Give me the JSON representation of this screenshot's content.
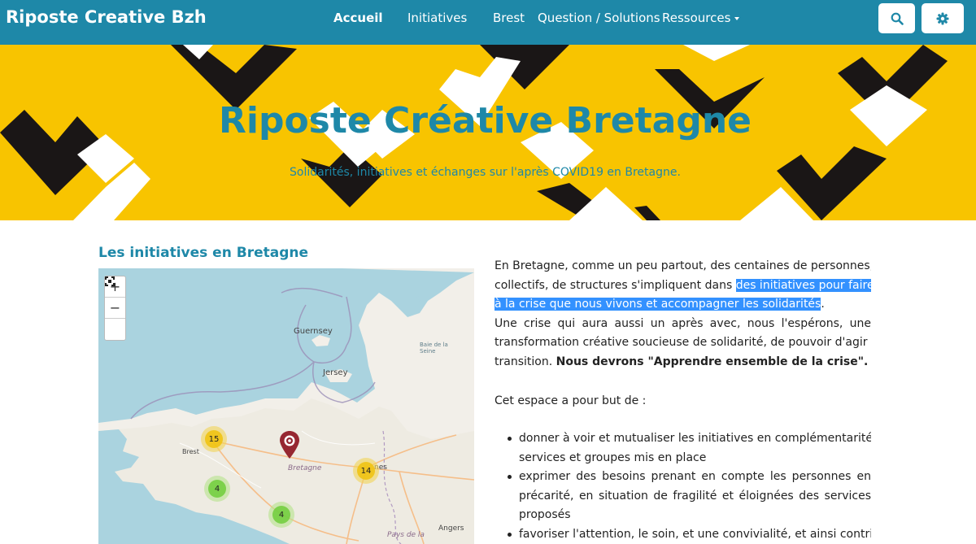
{
  "navbar": {
    "brand": "Riposte Creative Bzh",
    "links": [
      "Accueil",
      "Initiatives",
      "Brest",
      "Question / Solutions",
      "Ressources"
    ],
    "active": "Accueil",
    "search_icon": "search-icon",
    "settings_icon": "gear-icon",
    "color": "#1e88a8"
  },
  "hero": {
    "title": "Riposte Créative Bretagne",
    "subtitle": "Solidarités, initiatives et échanges sur l'après COVID19 en Bretagne.",
    "background": "#f8c400"
  },
  "section": {
    "title": "Les initiatives en Bretagne"
  },
  "map": {
    "zoom_in": "+",
    "zoom_out": "−",
    "labels": {
      "guernsey": "Guernsey",
      "jersey": "Jersey",
      "brest": "Brest",
      "bretagne": "Bretagne",
      "angers": "Angers",
      "pays_de_la": "Pays de la",
      "baie": "Baie de la Seine",
      "rennes_partial": "nes"
    },
    "clusters": [
      {
        "count": "15",
        "color": "yellow"
      },
      {
        "count": "14",
        "color": "yellow"
      },
      {
        "count": "4",
        "color": "green"
      },
      {
        "count": "4",
        "color": "green"
      }
    ],
    "marker_icon": "map-marker-icon",
    "fullscreen_icon": "fullscreen-icon"
  },
  "intro": {
    "l1": "En Bretagne, comme un peu partout, des centaines de personnes, de",
    "l2a": "collectifs, de structures s'impliquent dans ",
    "l2b": "des initiatives pour faire face",
    "l3a": "à la crise que nous vivons et accompagner les solidarités",
    "l3b": ".",
    "l4": "Une crise qui aura aussi un après avec, nous l'espérons, une",
    "l5": "transformation créative soucieuse de solidarité, de pouvoir d'agir et de",
    "l6a": "transition. ",
    "l6b": "Nous devrons \"Apprendre ensemble de la crise\".",
    "purpose": "Cet espace a pour but de :"
  },
  "bullets": [
    [
      "donner à voir et mutualiser les initiatives en complémentarité des",
      "services et groupes mis en place"
    ],
    [
      "exprimer des besoins prenant en compte les personnes en",
      "précarité, en situation de fragilité et éloignées des services",
      "proposés"
    ],
    [
      "favoriser l'attention, le soin, et une convivialité, et ainsi contribuer"
    ]
  ]
}
